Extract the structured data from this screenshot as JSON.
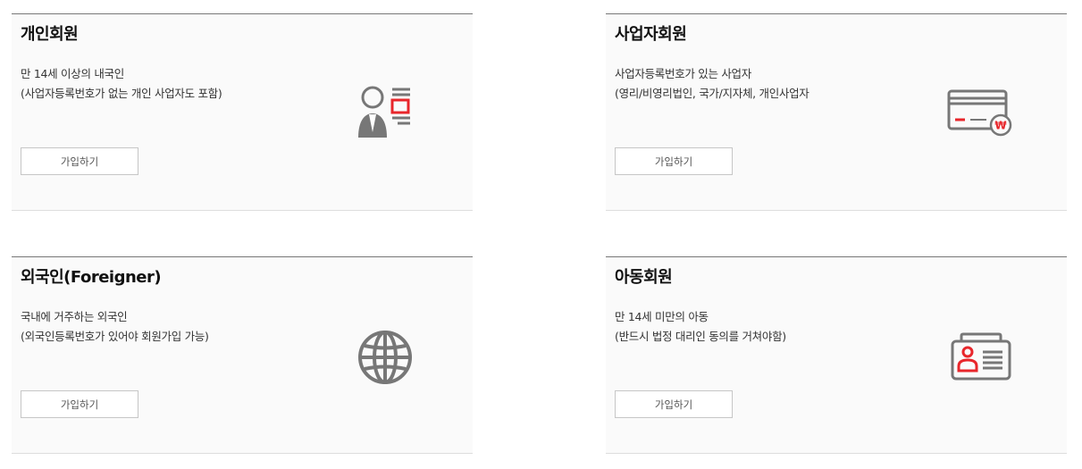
{
  "cards": [
    {
      "title": "개인회원",
      "desc": [
        "만 14세 이상의 내국인",
        "(사업자등록번호가 없는 개인 사업자도 포함)"
      ],
      "button": "가입하기",
      "icon": "person-id-icon"
    },
    {
      "title": "사업자회원",
      "desc": [
        "사업자등록번호가 있는 사업자",
        "(영리/비영리법인, 국가/지자체, 개인사업자"
      ],
      "button": "가입하기",
      "icon": "credit-card-won-icon",
      "icon_badge": "₩"
    },
    {
      "title": "외국인(Foreigner)",
      "desc": [
        "국내에 거주하는 외국인",
        "(외국인등록번호가 있어야 회원가입 가능)"
      ],
      "button": "가입하기",
      "icon": "globe-icon"
    },
    {
      "title": "아동회원",
      "desc": [
        "만 14세 미만의 아동",
        "(반드시 법정 대리인 동의를 거쳐야함)"
      ],
      "button": "가입하기",
      "icon": "child-id-card-icon"
    }
  ],
  "colors": {
    "icon_gray": "#777777",
    "accent_red": "#e8262b"
  }
}
